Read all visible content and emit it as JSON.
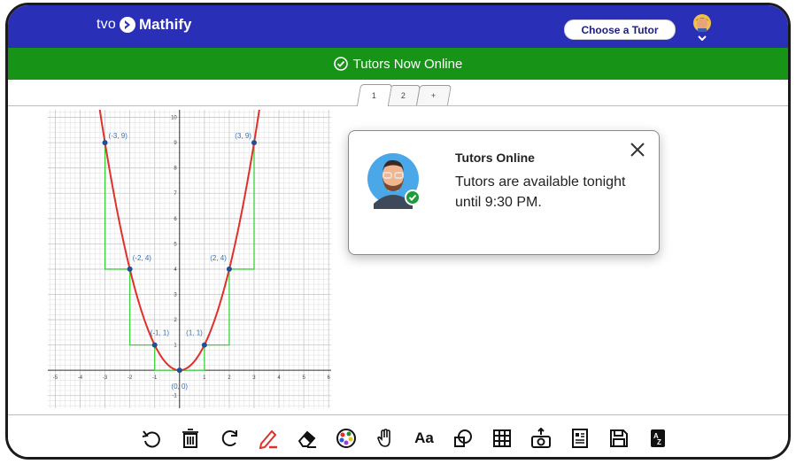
{
  "header": {
    "brand_prefix": "tvo",
    "app_name": "Mathify",
    "choose_tutor_label": "Choose a Tutor"
  },
  "status_bar": {
    "text": "Tutors Now Online",
    "color": "#179418"
  },
  "tabs": [
    {
      "label": "1",
      "active": true
    },
    {
      "label": "2",
      "active": false
    },
    {
      "label": "+",
      "active": false
    }
  ],
  "popup": {
    "title": "Tutors Online",
    "message": "Tutors are available tonight until 9:30 PM."
  },
  "toolbar": {
    "tools": [
      {
        "name": "undo-icon"
      },
      {
        "name": "trash-icon"
      },
      {
        "name": "redo-icon"
      },
      {
        "name": "pencil-icon"
      },
      {
        "name": "eraser-icon"
      },
      {
        "name": "color-palette-icon"
      },
      {
        "name": "hand-pan-icon"
      },
      {
        "name": "text-tool",
        "label": "Aa"
      },
      {
        "name": "shapes-icon"
      },
      {
        "name": "grid-table-icon"
      },
      {
        "name": "camera-upload-icon"
      },
      {
        "name": "worksheet-icon"
      },
      {
        "name": "save-icon"
      },
      {
        "name": "sort-az-icon"
      }
    ]
  },
  "graph": {
    "curve": "y = x^2",
    "x_ticks": [
      "-5",
      "-4",
      "-3",
      "-2",
      "-1",
      "0",
      "1",
      "2",
      "3",
      "4",
      "5",
      "6"
    ],
    "y_ticks": [
      "-1",
      "1",
      "2",
      "3",
      "4",
      "5",
      "6",
      "7",
      "8",
      "9",
      "10"
    ],
    "points": [
      {
        "x": -3,
        "y": 9,
        "label": "(-3, 9)"
      },
      {
        "x": 3,
        "y": 9,
        "label": "(3, 9)"
      },
      {
        "x": -2,
        "y": 4,
        "label": "(-2, 4)"
      },
      {
        "x": 2,
        "y": 4,
        "label": "(2, 4)"
      },
      {
        "x": -1,
        "y": 1,
        "label": "(-1, 1)"
      },
      {
        "x": 1,
        "y": 1,
        "label": "(1, 1)"
      },
      {
        "x": 0,
        "y": 0,
        "label": "(0, 0)"
      }
    ],
    "xlim": [
      -5.3,
      6.1
    ],
    "ylim": [
      -1.5,
      10.3
    ],
    "colors": {
      "curve": "#e0302a",
      "steps": "#39d139",
      "points": "#1f4f96",
      "labels": "#3c6fb0",
      "grid": "#e2e2e2"
    }
  }
}
